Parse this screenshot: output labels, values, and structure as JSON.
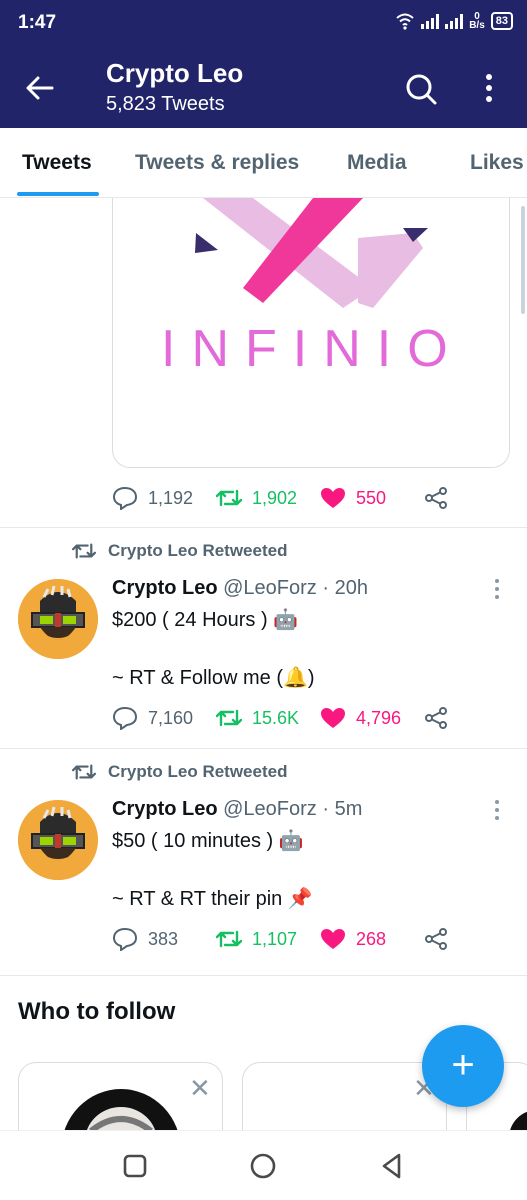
{
  "status_bar": {
    "time": "1:47",
    "net_speed_top": "0",
    "net_speed_unit": "B/s",
    "battery": "83"
  },
  "header": {
    "title": "Crypto Leo",
    "subtitle": "5,823 Tweets",
    "back_icon": "arrow-left-icon",
    "search_icon": "search-icon",
    "more_icon": "more-vertical-icon"
  },
  "tabs": [
    {
      "label": "Tweets",
      "active": true
    },
    {
      "label": "Tweets & replies",
      "active": false
    },
    {
      "label": "Media",
      "active": false
    },
    {
      "label": "Likes",
      "active": false
    }
  ],
  "tweet_image": {
    "logo_text": "INFINIO",
    "actions": {
      "replies": "1,192",
      "retweets": "1,902",
      "likes": "550"
    }
  },
  "tweets": [
    {
      "retweeted_by": "Crypto Leo Retweeted",
      "name": "Crypto Leo",
      "handle": "@LeoForz",
      "separator": "·",
      "time": "20h",
      "line1": "$200 ( 24 Hours ) 🤖",
      "line2": "~ RT & Follow me (🔔)",
      "actions": {
        "replies": "7,160",
        "retweets": "15.6K",
        "likes": "4,796"
      }
    },
    {
      "retweeted_by": "Crypto Leo Retweeted",
      "name": "Crypto Leo",
      "handle": "@LeoForz",
      "separator": "·",
      "time": "5m",
      "line1": "$50 ( 10 minutes ) 🤖",
      "line2": "~ RT & RT their pin 📌",
      "actions": {
        "replies": "383",
        "retweets": "1,107",
        "likes": "268"
      }
    }
  ],
  "who_to_follow": {
    "title": "Who to follow",
    "close_symbol": "✕"
  },
  "fab": {
    "symbol": "+"
  },
  "colors": {
    "header_bg": "#22246a",
    "accent": "#1d9bf0",
    "retweet": "#17bf63",
    "like": "#f91880",
    "muted": "#536471"
  }
}
